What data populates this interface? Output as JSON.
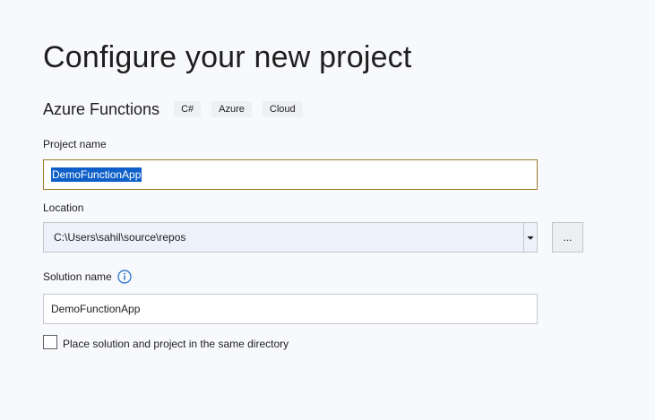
{
  "page": {
    "title": "Configure your new project"
  },
  "template": {
    "name": "Azure Functions",
    "tags": [
      "C#",
      "Azure",
      "Cloud"
    ]
  },
  "project_name": {
    "label": "Project name",
    "value": "DemoFunctionApp",
    "text_selected": true
  },
  "location": {
    "label": "Location",
    "value": "C:\\Users\\sahil\\source\\repos",
    "browse_label": "..."
  },
  "solution_name": {
    "label": "Solution name",
    "value": "DemoFunctionApp",
    "info_icon": "info-icon"
  },
  "same_directory": {
    "label": "Place solution and project in the same directory",
    "checked": false
  },
  "colors": {
    "background": "#f8f9fc",
    "selection": "#0e60c8",
    "info_accent": "#1b6ac9",
    "focus_border": "#9a7a2a"
  }
}
